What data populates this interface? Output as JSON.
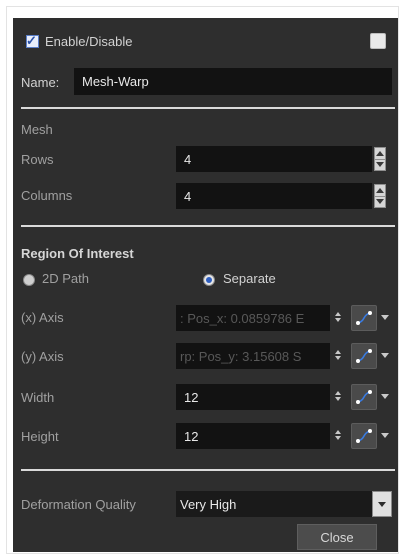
{
  "enable": {
    "label": "Enable/Disable",
    "checked": true
  },
  "name": {
    "label": "Name:",
    "value": "Mesh-Warp"
  },
  "mesh": {
    "heading": "Mesh",
    "rows_label": "Rows",
    "rows_value": "4",
    "columns_label": "Columns",
    "columns_value": "4"
  },
  "roi": {
    "heading": "Region Of Interest",
    "option_2dpath": "2D Path",
    "option_separate": "Separate",
    "selected": "Separate",
    "x_label": "(x) Axis",
    "x_value": ": Pos_x: 0.0859786 E",
    "y_label": "(y) Axis",
    "y_value": "rp: Pos_y: 3.15608 S",
    "width_label": "Width",
    "width_value": "12",
    "height_label": "Height",
    "height_value": "12"
  },
  "deformation": {
    "label": "Deformation Quality",
    "value": "Very High"
  },
  "close_label": "Close",
  "icons": {
    "function_button": "function-curve-icon",
    "dropdown": "chevron-down-icon",
    "spin": "spinbox-arrows-icon"
  }
}
